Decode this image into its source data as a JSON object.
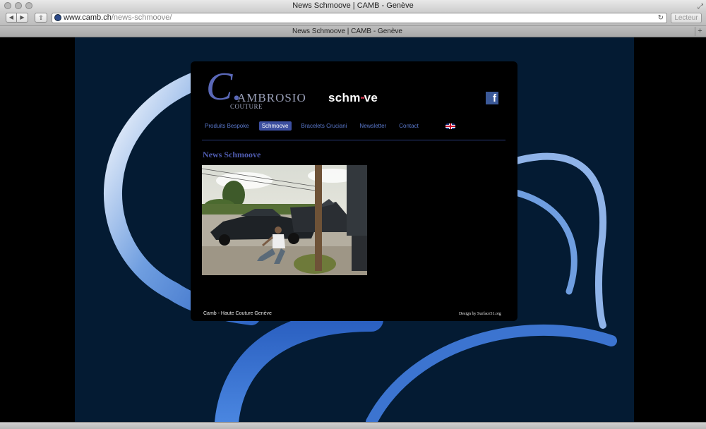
{
  "window": {
    "title": "News Schmoove | CAMB - Genève"
  },
  "toolbar": {
    "back_glyph": "◀",
    "forward_glyph": "▶",
    "share_glyph": "⇪",
    "url_domain": "www.camb.ch",
    "url_path": "/news-schmoove/",
    "reload_glyph": "↻",
    "reader_label": "Lecteur"
  },
  "tabs": [
    {
      "label": "News Schmoove | CAMB - Genève"
    }
  ],
  "tabbar": {
    "new_tab_glyph": "+"
  },
  "logo": {
    "letter": "C.",
    "name": "AMBROSIO",
    "sub": "COUTURE"
  },
  "brand": {
    "schm": "schm",
    "dots": "••",
    "ve": "ve"
  },
  "social": {
    "facebook_glyph": "f"
  },
  "nav": [
    {
      "label": "Produits Bespoke"
    },
    {
      "label": "Schmoove"
    },
    {
      "label": "Bracelets Cruciani"
    },
    {
      "label": "Newsletter"
    },
    {
      "label": "Contact"
    }
  ],
  "page": {
    "title": "News Schmoove"
  },
  "footer": {
    "left": "Camb - Haute Couture Genève",
    "right": "Design by Surface51.org"
  },
  "colors": {
    "background_panel": "#041b33",
    "nav_link": "#5a78cc",
    "nav_active": "#3c4fa0",
    "title": "#4f5cb0"
  }
}
